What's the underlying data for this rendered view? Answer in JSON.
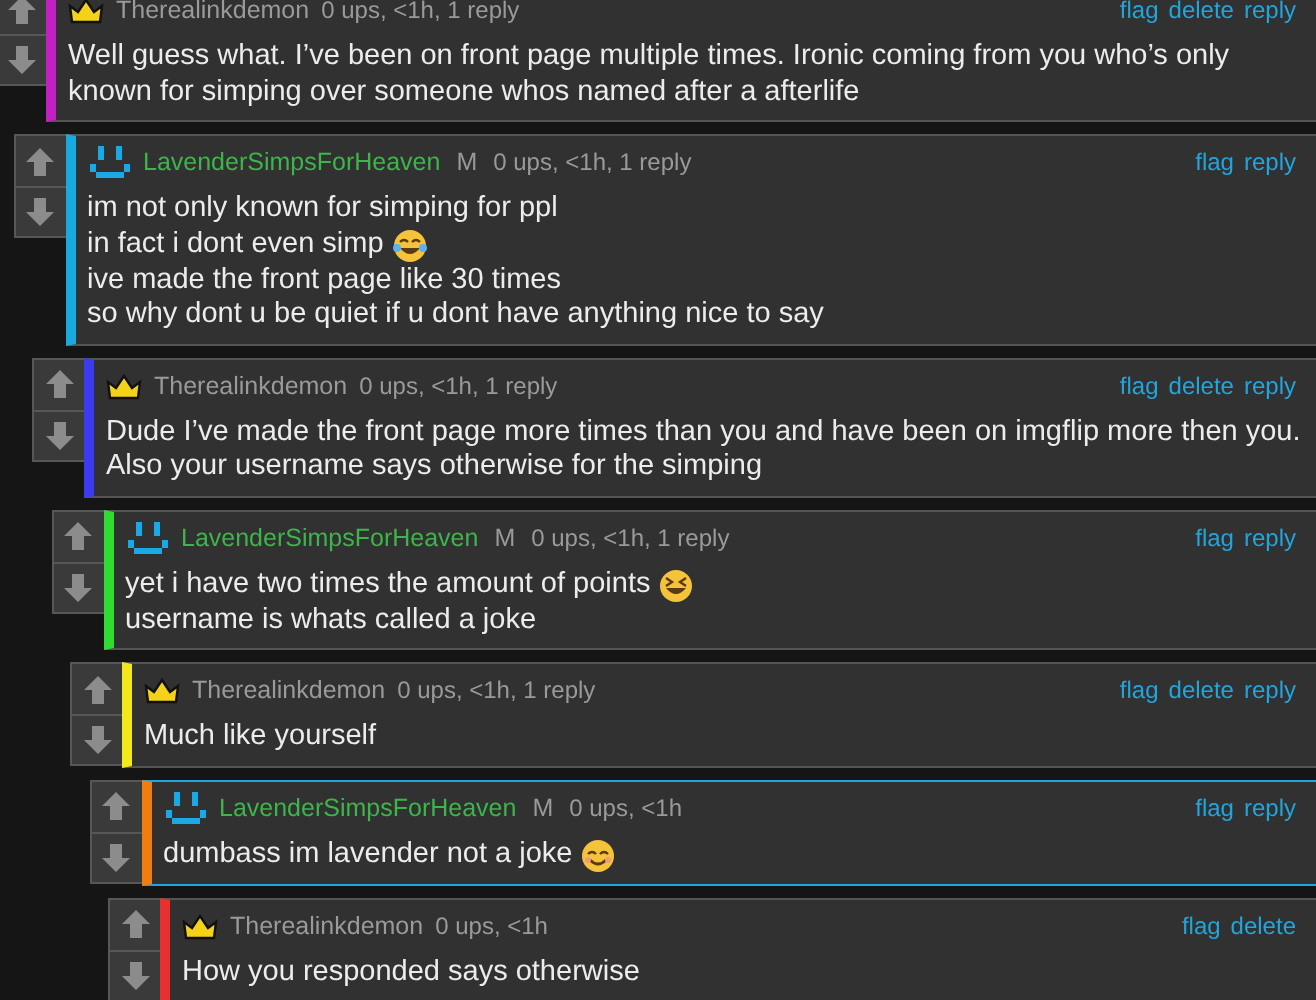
{
  "comments": [
    {
      "author": "Therealinkdemon",
      "kind": "crown",
      "meta": "0 ups, <1h, 1 reply",
      "actions": [
        "flag",
        "delete",
        "reply"
      ],
      "color": "#c21fc4",
      "highlighted": false,
      "lines": [
        {
          "text": "Well guess what. I’ve been on front page multiple times. Ironic coming from you who’s only known for simping over someone whos named after a afterlife"
        }
      ],
      "children": [
        {
          "author": "LavenderSimpsForHeaven",
          "kind": "face",
          "badge": "M",
          "meta": "0 ups, <1h, 1 reply",
          "actions": [
            "flag",
            "reply"
          ],
          "color": "#18a9e0",
          "highlighted": false,
          "lines": [
            {
              "text": "im not only known for simping for ppl"
            },
            {
              "text": "in fact i dont even simp",
              "emoji": {
                "kind": "tears"
              }
            },
            {
              "text": "ive made the front page like 30 times"
            },
            {
              "text": "so why dont u be quiet if u dont have anything nice to say"
            }
          ],
          "children": [
            {
              "author": "Therealinkdemon",
              "kind": "crown",
              "meta": "0 ups, <1h, 1 reply",
              "actions": [
                "flag",
                "delete",
                "reply"
              ],
              "color": "#3b3bf0",
              "highlighted": false,
              "lines": [
                {
                  "text": "Dude I’ve made the front page more times than you and have been on imgflip more then you. Also your username says otherwise for the simping"
                }
              ],
              "children": [
                {
                  "author": "LavenderSimpsForHeaven",
                  "kind": "face",
                  "badge": "M",
                  "meta": "0 ups, <1h, 1 reply",
                  "actions": [
                    "flag",
                    "reply"
                  ],
                  "color": "#2fdc2f",
                  "highlighted": false,
                  "lines": [
                    {
                      "text": "yet i have two times the amount of points",
                      "emoji": {
                        "kind": "squint"
                      }
                    },
                    {
                      "text": "username is whats called a joke"
                    }
                  ],
                  "children": [
                    {
                      "author": "Therealinkdemon",
                      "kind": "crown",
                      "meta": "0 ups, <1h, 1 reply",
                      "actions": [
                        "flag",
                        "delete",
                        "reply"
                      ],
                      "color": "#f2e81c",
                      "highlighted": false,
                      "lines": [
                        {
                          "text": "Much like yourself"
                        }
                      ],
                      "children": [
                        {
                          "author": "LavenderSimpsForHeaven",
                          "kind": "face",
                          "badge": "M",
                          "meta": "0 ups, <1h",
                          "actions": [
                            "flag",
                            "reply"
                          ],
                          "color": "#f07d10",
                          "highlighted": true,
                          "lines": [
                            {
                              "text": "dumbass im lavender not a joke",
                              "emoji": {
                                "kind": "smile"
                              }
                            }
                          ],
                          "children": [
                            {
                              "author": "Therealinkdemon",
                              "kind": "crown",
                              "meta": "0 ups, <1h",
                              "actions": [
                                "flag",
                                "delete"
                              ],
                              "color": "#e8302e",
                              "highlighted": false,
                              "lines": [
                                {
                                  "text": "How you responded says otherwise"
                                }
                              ]
                            }
                          ]
                        }
                      ]
                    }
                  ]
                }
              ]
            }
          ]
        }
      ]
    }
  ]
}
